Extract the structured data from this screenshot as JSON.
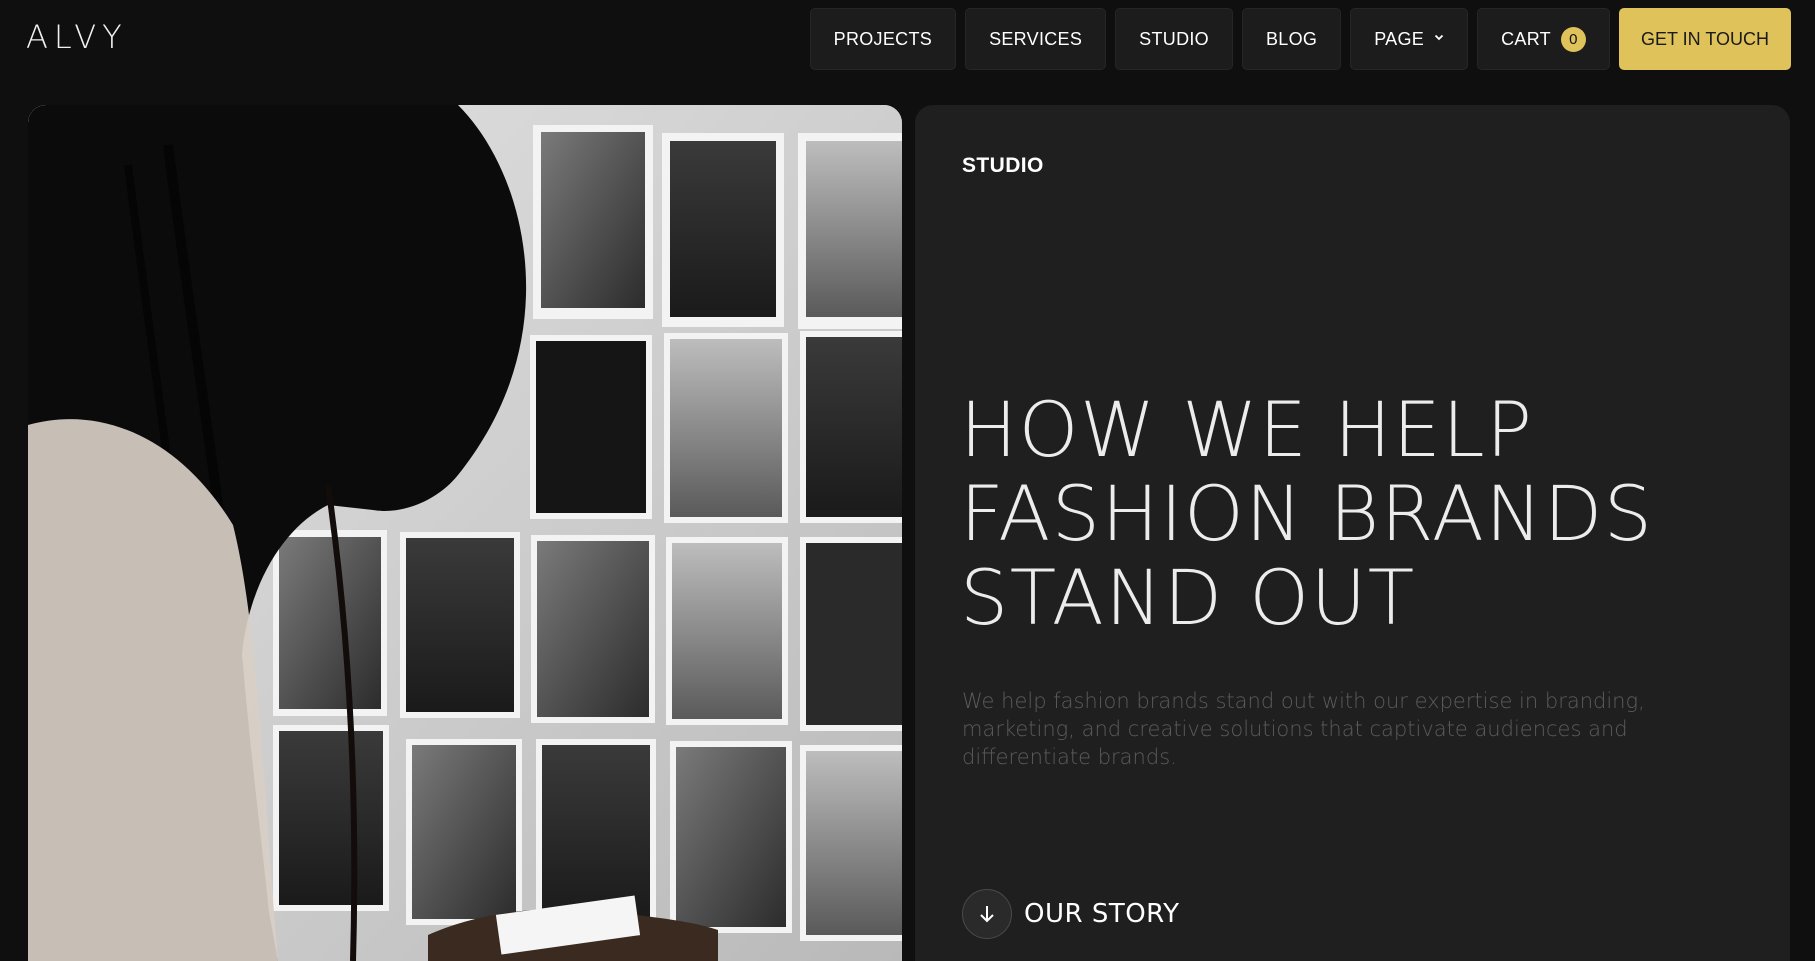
{
  "brand": {
    "logo": "ALVY"
  },
  "nav": {
    "items": [
      {
        "label": "PROJECTS"
      },
      {
        "label": "SERVICES"
      },
      {
        "label": "STUDIO"
      },
      {
        "label": "BLOG"
      },
      {
        "label": "PAGE",
        "icon": "chevron-down-icon"
      }
    ],
    "cart": {
      "label": "CART",
      "count": "0"
    },
    "cta": {
      "label": "GET IN TOUCH"
    }
  },
  "hero": {
    "eyebrow": "STUDIO",
    "headline": [
      "HOW WE HELP",
      "FASHION BRANDS",
      "STAND OUT"
    ],
    "description": "We help fashion brands stand out with our expertise in branding, marketing, and creative solutions that captivate audiences and differentiate brands.",
    "cta": {
      "label": "OUR STORY",
      "icon": "arrow-down-icon"
    }
  },
  "colors": {
    "page_bg": "#0f0f0f",
    "panel_bg": "#1f1f1f",
    "nav_bg": "#1c1c1c",
    "accent": "#dfc25a",
    "text": "#ffffff",
    "muted": "#5b5b5b"
  }
}
